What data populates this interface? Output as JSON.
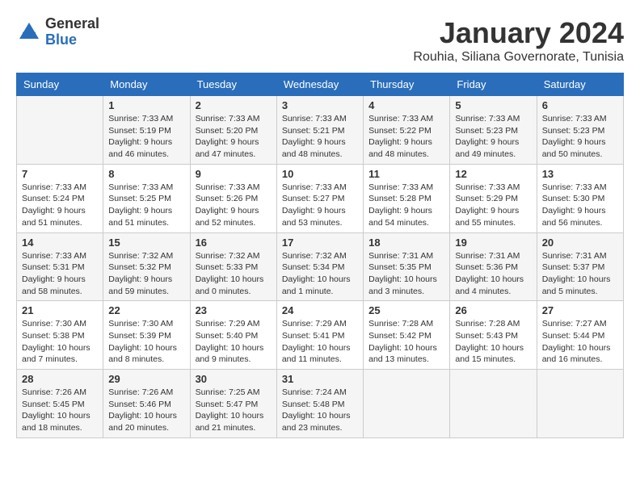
{
  "logo": {
    "general": "General",
    "blue": "Blue"
  },
  "title": {
    "month_year": "January 2024",
    "location": "Rouhia, Siliana Governorate, Tunisia"
  },
  "days_of_week": [
    "Sunday",
    "Monday",
    "Tuesday",
    "Wednesday",
    "Thursday",
    "Friday",
    "Saturday"
  ],
  "weeks": [
    [
      {
        "day": "",
        "info": ""
      },
      {
        "day": "1",
        "info": "Sunrise: 7:33 AM\nSunset: 5:19 PM\nDaylight: 9 hours\nand 46 minutes."
      },
      {
        "day": "2",
        "info": "Sunrise: 7:33 AM\nSunset: 5:20 PM\nDaylight: 9 hours\nand 47 minutes."
      },
      {
        "day": "3",
        "info": "Sunrise: 7:33 AM\nSunset: 5:21 PM\nDaylight: 9 hours\nand 48 minutes."
      },
      {
        "day": "4",
        "info": "Sunrise: 7:33 AM\nSunset: 5:22 PM\nDaylight: 9 hours\nand 48 minutes."
      },
      {
        "day": "5",
        "info": "Sunrise: 7:33 AM\nSunset: 5:23 PM\nDaylight: 9 hours\nand 49 minutes."
      },
      {
        "day": "6",
        "info": "Sunrise: 7:33 AM\nSunset: 5:23 PM\nDaylight: 9 hours\nand 50 minutes."
      }
    ],
    [
      {
        "day": "7",
        "info": "Sunrise: 7:33 AM\nSunset: 5:24 PM\nDaylight: 9 hours\nand 51 minutes."
      },
      {
        "day": "8",
        "info": "Sunrise: 7:33 AM\nSunset: 5:25 PM\nDaylight: 9 hours\nand 51 minutes."
      },
      {
        "day": "9",
        "info": "Sunrise: 7:33 AM\nSunset: 5:26 PM\nDaylight: 9 hours\nand 52 minutes."
      },
      {
        "day": "10",
        "info": "Sunrise: 7:33 AM\nSunset: 5:27 PM\nDaylight: 9 hours\nand 53 minutes."
      },
      {
        "day": "11",
        "info": "Sunrise: 7:33 AM\nSunset: 5:28 PM\nDaylight: 9 hours\nand 54 minutes."
      },
      {
        "day": "12",
        "info": "Sunrise: 7:33 AM\nSunset: 5:29 PM\nDaylight: 9 hours\nand 55 minutes."
      },
      {
        "day": "13",
        "info": "Sunrise: 7:33 AM\nSunset: 5:30 PM\nDaylight: 9 hours\nand 56 minutes."
      }
    ],
    [
      {
        "day": "14",
        "info": "Sunrise: 7:33 AM\nSunset: 5:31 PM\nDaylight: 9 hours\nand 58 minutes."
      },
      {
        "day": "15",
        "info": "Sunrise: 7:32 AM\nSunset: 5:32 PM\nDaylight: 9 hours\nand 59 minutes."
      },
      {
        "day": "16",
        "info": "Sunrise: 7:32 AM\nSunset: 5:33 PM\nDaylight: 10 hours\nand 0 minutes."
      },
      {
        "day": "17",
        "info": "Sunrise: 7:32 AM\nSunset: 5:34 PM\nDaylight: 10 hours\nand 1 minute."
      },
      {
        "day": "18",
        "info": "Sunrise: 7:31 AM\nSunset: 5:35 PM\nDaylight: 10 hours\nand 3 minutes."
      },
      {
        "day": "19",
        "info": "Sunrise: 7:31 AM\nSunset: 5:36 PM\nDaylight: 10 hours\nand 4 minutes."
      },
      {
        "day": "20",
        "info": "Sunrise: 7:31 AM\nSunset: 5:37 PM\nDaylight: 10 hours\nand 5 minutes."
      }
    ],
    [
      {
        "day": "21",
        "info": "Sunrise: 7:30 AM\nSunset: 5:38 PM\nDaylight: 10 hours\nand 7 minutes."
      },
      {
        "day": "22",
        "info": "Sunrise: 7:30 AM\nSunset: 5:39 PM\nDaylight: 10 hours\nand 8 minutes."
      },
      {
        "day": "23",
        "info": "Sunrise: 7:29 AM\nSunset: 5:40 PM\nDaylight: 10 hours\nand 9 minutes."
      },
      {
        "day": "24",
        "info": "Sunrise: 7:29 AM\nSunset: 5:41 PM\nDaylight: 10 hours\nand 11 minutes."
      },
      {
        "day": "25",
        "info": "Sunrise: 7:28 AM\nSunset: 5:42 PM\nDaylight: 10 hours\nand 13 minutes."
      },
      {
        "day": "26",
        "info": "Sunrise: 7:28 AM\nSunset: 5:43 PM\nDaylight: 10 hours\nand 15 minutes."
      },
      {
        "day": "27",
        "info": "Sunrise: 7:27 AM\nSunset: 5:44 PM\nDaylight: 10 hours\nand 16 minutes."
      }
    ],
    [
      {
        "day": "28",
        "info": "Sunrise: 7:26 AM\nSunset: 5:45 PM\nDaylight: 10 hours\nand 18 minutes."
      },
      {
        "day": "29",
        "info": "Sunrise: 7:26 AM\nSunset: 5:46 PM\nDaylight: 10 hours\nand 20 minutes."
      },
      {
        "day": "30",
        "info": "Sunrise: 7:25 AM\nSunset: 5:47 PM\nDaylight: 10 hours\nand 21 minutes."
      },
      {
        "day": "31",
        "info": "Sunrise: 7:24 AM\nSunset: 5:48 PM\nDaylight: 10 hours\nand 23 minutes."
      },
      {
        "day": "",
        "info": ""
      },
      {
        "day": "",
        "info": ""
      },
      {
        "day": "",
        "info": ""
      }
    ]
  ]
}
